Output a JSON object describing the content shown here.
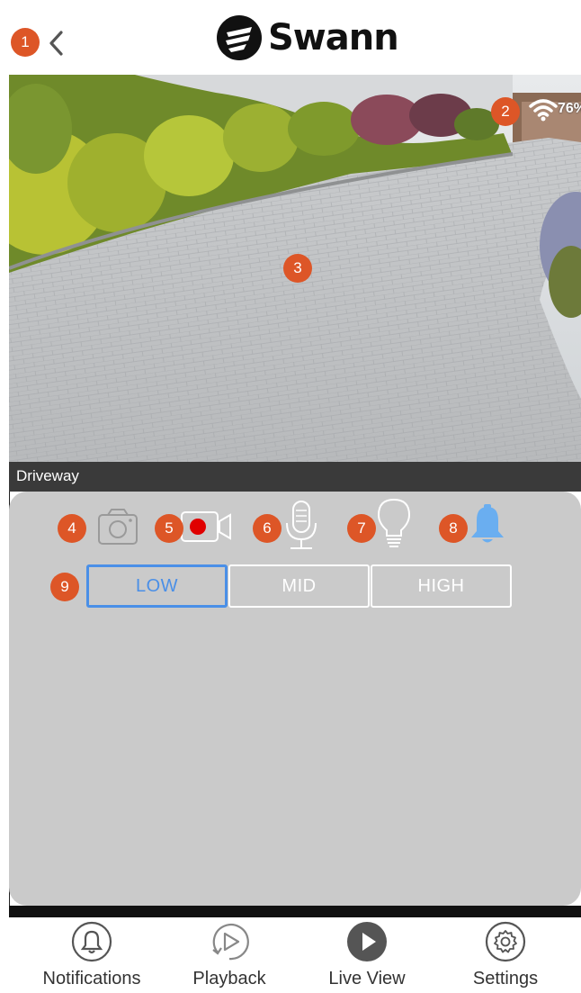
{
  "header": {
    "logo_text": "Swann",
    "back_label": "Back"
  },
  "markers": [
    "1",
    "2",
    "3",
    "4",
    "5",
    "6",
    "7",
    "8",
    "9"
  ],
  "video": {
    "signal_strength": "76%"
  },
  "camera": {
    "name": "Driveway"
  },
  "controls": {
    "icons": [
      "camera-snapshot-icon",
      "record-icon",
      "microphone-icon",
      "light-bulb-icon",
      "bell-icon"
    ],
    "record_color": "#e00000",
    "bell_color": "#6aaef0"
  },
  "quality": {
    "options": [
      "LOW",
      "MID",
      "HIGH"
    ],
    "selected": "LOW",
    "active_color": "#4a8fe7"
  },
  "nav": {
    "items": [
      {
        "label": "Notifications",
        "icon": "bell-icon"
      },
      {
        "label": "Playback",
        "icon": "playback-icon"
      },
      {
        "label": "Live View",
        "icon": "play-icon"
      },
      {
        "label": "Settings",
        "icon": "gear-icon"
      }
    ]
  },
  "colors": {
    "marker": "#dd5627",
    "panel": "#cacaca"
  }
}
